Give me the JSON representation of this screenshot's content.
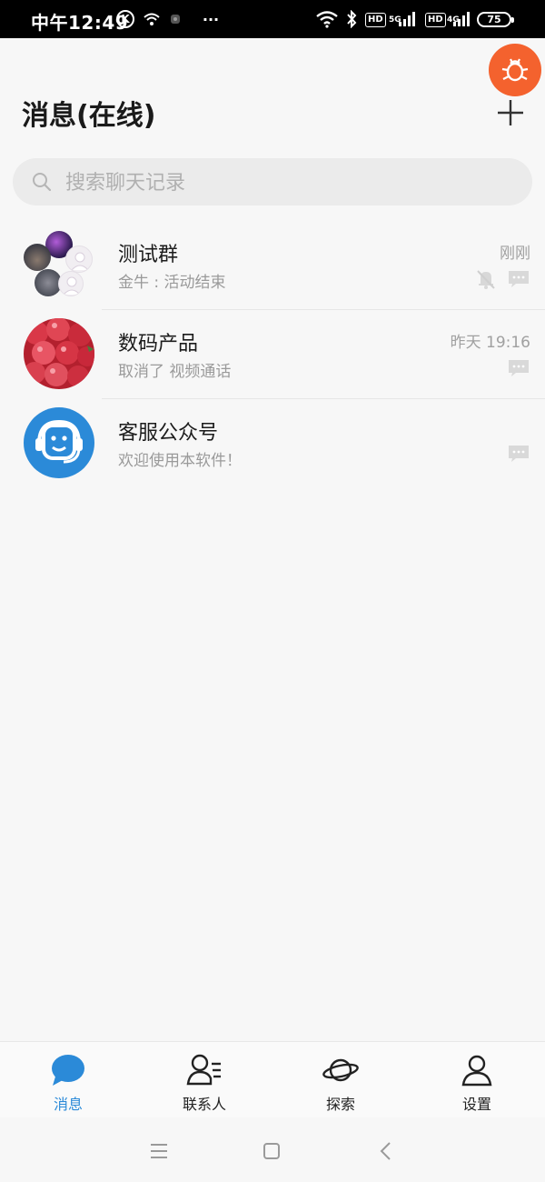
{
  "status_bar": {
    "time": "中午12:49",
    "k_label": "K",
    "more": "···",
    "hd1": "HD",
    "net1": "5G",
    "hd2": "HD",
    "net2": "4G",
    "battery": "75"
  },
  "header": {
    "title": "消息(在线)"
  },
  "search": {
    "placeholder": "搜索聊天记录"
  },
  "conversations": [
    {
      "name": "测试群",
      "preview": "金牛 : 活动结束",
      "time": "刚刚",
      "muted": true,
      "avatar": "group-avatar"
    },
    {
      "name": "数码产品",
      "preview": "取消了 视频通话",
      "time": "昨天 19:16",
      "muted": false,
      "avatar": "radish-photo"
    },
    {
      "name": "客服公众号",
      "preview": "欢迎使用本软件！",
      "time": "",
      "muted": false,
      "avatar": "customer-service-icon"
    }
  ],
  "bottom_nav": {
    "items": [
      {
        "label": "消息",
        "icon": "chat-bubble-icon",
        "active": true
      },
      {
        "label": "联系人",
        "icon": "contacts-icon",
        "active": false
      },
      {
        "label": "探索",
        "icon": "planet-icon",
        "active": false
      },
      {
        "label": "设置",
        "icon": "person-icon",
        "active": false
      }
    ]
  },
  "colors": {
    "accent": "#2b8ad8",
    "bug_button": "#f4622e",
    "service_avatar": "#2b8ad8"
  }
}
